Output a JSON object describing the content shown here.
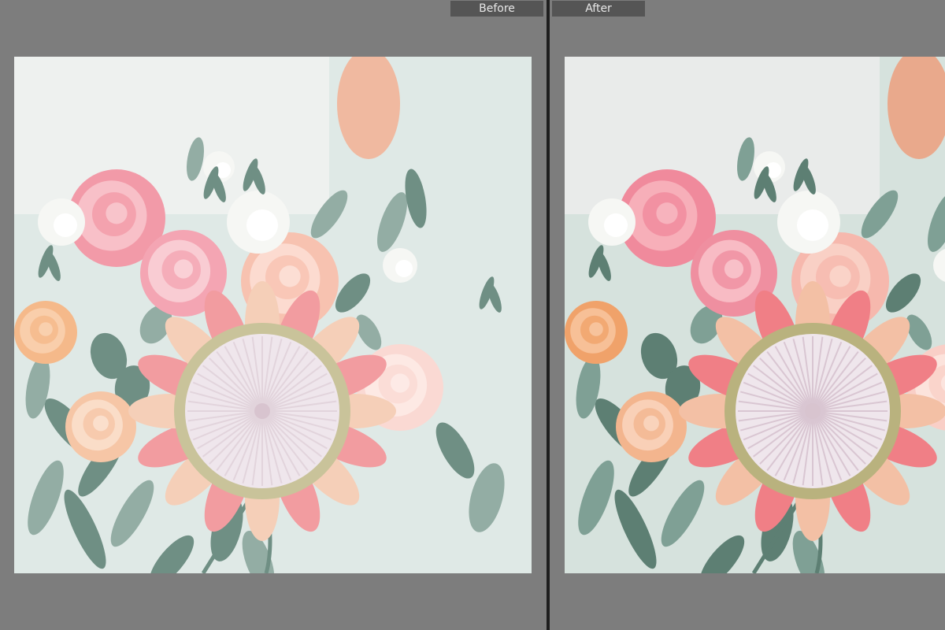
{
  "before_label": "Before",
  "after_label": "After",
  "photo": {
    "subject": "bridal-bouquet-protea-roses",
    "palette": {
      "background": "#dfe9e6",
      "rose_pink": "#f29aa8",
      "peach": "#f7c2b0",
      "protea_center": "#efe6ec",
      "leaf": "#6f8f84"
    }
  }
}
